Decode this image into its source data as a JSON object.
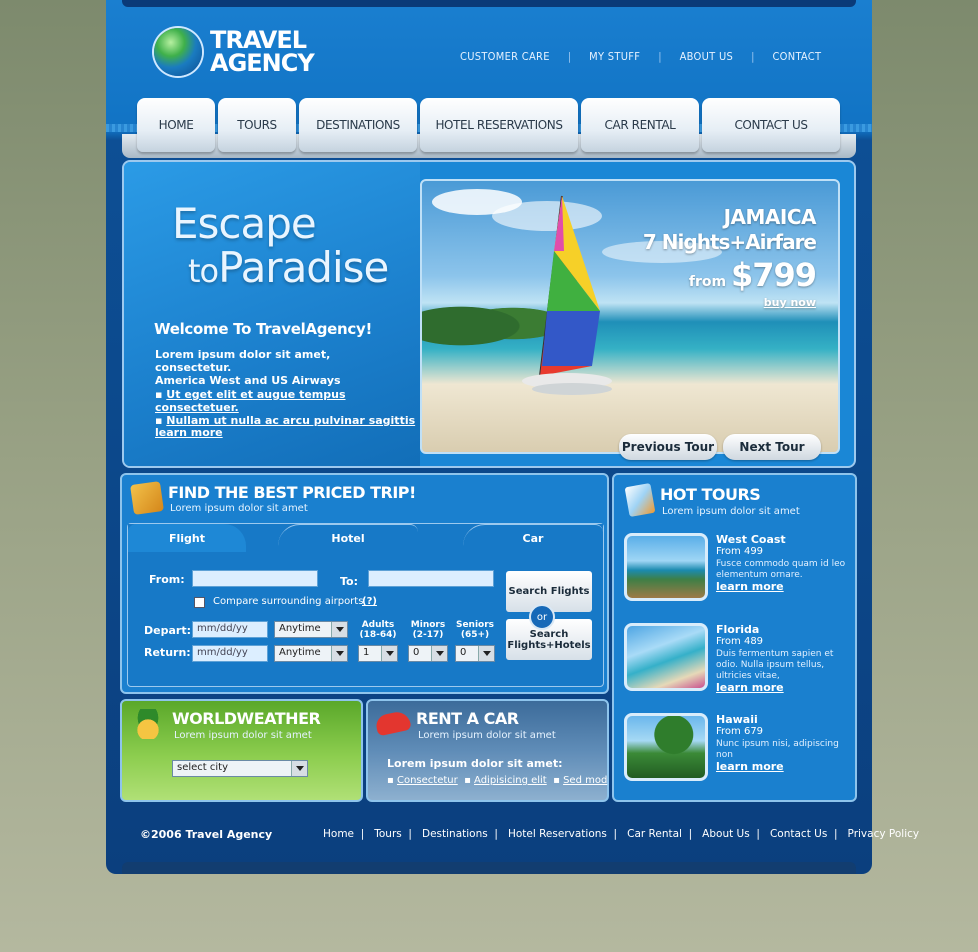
{
  "brand": {
    "line1": "TRAVEL",
    "line2": "AGENCY"
  },
  "top_links": [
    "CUSTOMER CARE",
    "MY STUFF",
    "ABOUT US",
    "CONTACT"
  ],
  "nav_tabs": [
    "HOME",
    "TOURS",
    "DESTINATIONS",
    "HOTEL RESERVATIONS",
    "CAR RENTAL",
    "CONTACT US"
  ],
  "hero": {
    "headline_1": "Escape",
    "headline_2": "to",
    "headline_3": "Paradise",
    "welcome": "Welcome To TravelAgency!",
    "body_1": "Lorem ipsum dolor sit amet, consectetur.",
    "body_2": "America West and US Airways",
    "bullets": [
      "Ut eget elit et augue tempus consectetuer.",
      "Nullam ut nulla ac arcu pulvinar sagittis"
    ],
    "learn_more": "learn more",
    "promo_1": "JAMAICA",
    "promo_2": "7 Nights+Airfare",
    "promo_3": "from",
    "promo_price": "$799",
    "promo_cta": "buy now",
    "prev_label": "Previous Tour",
    "next_label": "Next Tour"
  },
  "trip": {
    "title": "FIND THE BEST PRICED TRIP!",
    "subtitle": "Lorem ipsum dolor sit amet",
    "tabs": [
      "Flight",
      "Hotel",
      "Car"
    ],
    "from_label": "From:",
    "to_label": "To:",
    "compare_label": "Compare surrounding airports",
    "compare_help": "(?)",
    "depart_label": "Depart:",
    "return_label": "Return:",
    "date_placeholder": "mm/dd/yy",
    "time_value": "Anytime",
    "adults_label": "Adults",
    "adults_range": "(18-64)",
    "minors_label": "Minors",
    "minors_range": "(2-17)",
    "seniors_label": "Seniors",
    "seniors_range": "(65+)",
    "adults_value": "1",
    "minors_value": "0",
    "seniors_value": "0",
    "search_flights": "Search Flights",
    "or": "or",
    "search_combo_1": "Search",
    "search_combo_2": "Flights+Hotels"
  },
  "hot_tours": {
    "title": "HOT TOURS",
    "subtitle": "Lorem ipsum dolor sit amet",
    "items": [
      {
        "name": "West Coast",
        "price": "From 499",
        "desc": "Fusce commodo quam id leo elementum ornare.",
        "link": "learn more"
      },
      {
        "name": "Florida",
        "price": "From 489",
        "desc": "Duis fermentum sapien et odio. Nulla ipsum tellus, ultricies vitae,",
        "link": "learn more"
      },
      {
        "name": "Hawaii",
        "price": "From 679",
        "desc": "Nunc ipsum nisi, adipiscing non",
        "link": "learn more"
      }
    ]
  },
  "weather": {
    "title": "WORLDWEATHER",
    "subtitle": "Lorem ipsum dolor sit amet",
    "select_value": "select city"
  },
  "car": {
    "title": "RENT A CAR",
    "subtitle": "Lorem ipsum dolor sit amet",
    "body": "Lorem ipsum dolor sit amet:",
    "links": [
      "Consectetur",
      "Adipisicing elit",
      "Sed mod"
    ]
  },
  "footer": {
    "copyright": "©2006 Travel Agency",
    "links": [
      "Home",
      "Tours",
      "Destinations",
      "Hotel Reservations",
      "Car Rental",
      "About Us",
      "Contact Us",
      "Privacy Policy"
    ]
  },
  "colors": {
    "frame_blue": "#1173c4",
    "accent_green": "#8ccd4e",
    "panel_blue": "#1a80cf"
  }
}
